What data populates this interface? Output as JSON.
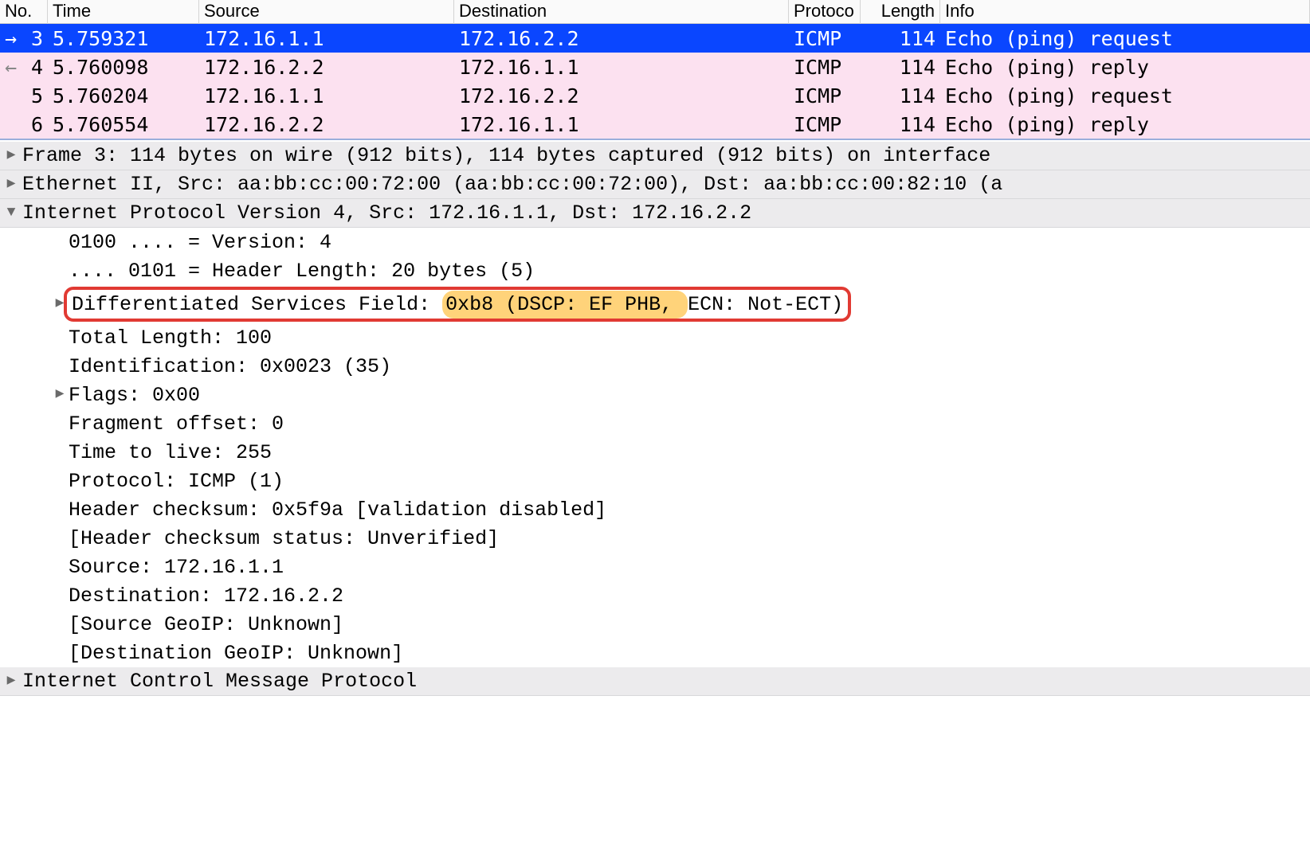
{
  "columns": {
    "no": "No.",
    "time": "Time",
    "src": "Source",
    "dst": "Destination",
    "prot": "Protoco",
    "len": "Length",
    "info": "Info"
  },
  "packets": [
    {
      "arrow": "→",
      "no": "3",
      "time": "5.759321",
      "src": "172.16.1.1",
      "dst": "172.16.2.2",
      "prot": "ICMP",
      "len": "114",
      "info": "Echo (ping) request"
    },
    {
      "arrow": "←",
      "no": "4",
      "time": "5.760098",
      "src": "172.16.2.2",
      "dst": "172.16.1.1",
      "prot": "ICMP",
      "len": "114",
      "info": "Echo (ping) reply"
    },
    {
      "arrow": "",
      "no": "5",
      "time": "5.760204",
      "src": "172.16.1.1",
      "dst": "172.16.2.2",
      "prot": "ICMP",
      "len": "114",
      "info": "Echo (ping) request"
    },
    {
      "arrow": "",
      "no": "6",
      "time": "5.760554",
      "src": "172.16.2.2",
      "dst": "172.16.1.1",
      "prot": "ICMP",
      "len": "114",
      "info": "Echo (ping) reply"
    }
  ],
  "details": {
    "frame": "Frame 3: 114 bytes on wire (912 bits), 114 bytes captured (912 bits) on interface",
    "eth": "Ethernet II, Src: aa:bb:cc:00:72:00 (aa:bb:cc:00:72:00), Dst: aa:bb:cc:00:82:10 (a",
    "ip": "Internet Protocol Version 4, Src: 172.16.1.1, Dst: 172.16.2.2",
    "version": "0100 .... = Version: 4",
    "hlen": ".... 0101 = Header Length: 20 bytes (5)",
    "dsf_pre": "Differentiated Services Field: ",
    "dsf_hl": "0xb8 (DSCP: EF PHB, ",
    "dsf_post": "ECN: Not-ECT)",
    "totlen": "Total Length: 100",
    "ident": "Identification: 0x0023 (35)",
    "flags": "Flags: 0x00",
    "fragoff": "Fragment offset: 0",
    "ttl": "Time to live: 255",
    "proto": "Protocol: ICMP (1)",
    "cksum": "Header checksum: 0x5f9a [validation disabled]",
    "ckstat": "[Header checksum status: Unverified]",
    "srcip": "Source: 172.16.1.1",
    "dstip": "Destination: 172.16.2.2",
    "sgeo": "[Source GeoIP: Unknown]",
    "dgeo": "[Destination GeoIP: Unknown]",
    "icmp": "Internet Control Message Protocol"
  }
}
